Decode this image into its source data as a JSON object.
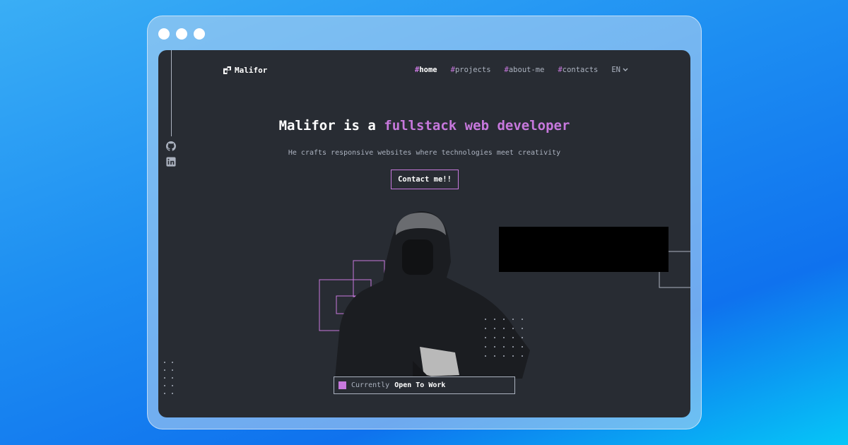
{
  "window": {
    "controls": [
      "close",
      "minimize",
      "maximize"
    ]
  },
  "brand": {
    "name": "Malifor",
    "icon": "logo-icon"
  },
  "nav": {
    "items": [
      {
        "hash": "#",
        "label": "home",
        "active": true
      },
      {
        "hash": "#",
        "label": "projects",
        "active": false
      },
      {
        "hash": "#",
        "label": "about-me",
        "active": false
      },
      {
        "hash": "#",
        "label": "contacts",
        "active": false
      }
    ],
    "language": "EN"
  },
  "social": {
    "icons": [
      "github-icon",
      "linkedin-icon"
    ]
  },
  "hero": {
    "title_prefix": "Malifor is a ",
    "title_accent": "fullstack web developer",
    "subtitle": "He crafts responsive websites where technologies meet creativity",
    "cta_label": "Contact me!!"
  },
  "status": {
    "prefix": "Currently",
    "value": "Open To Work"
  },
  "colors": {
    "background": "#282c33",
    "accent": "#c778dd",
    "text": "#abb2bf",
    "heading": "#ffffff"
  }
}
